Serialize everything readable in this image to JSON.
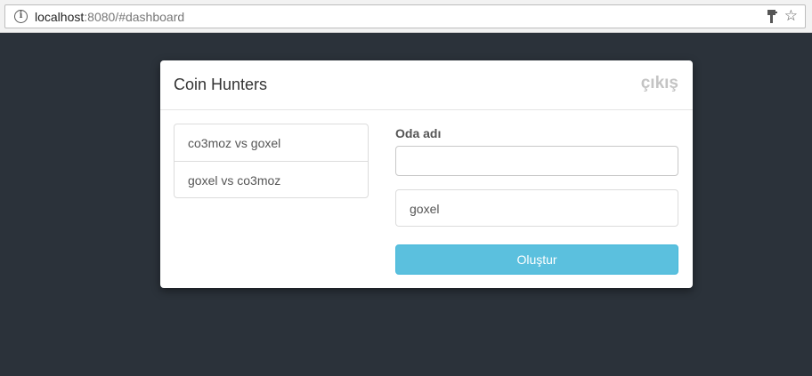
{
  "browser": {
    "url_host": "localhost",
    "url_rest": ":8080/#dashboard",
    "info_icon_glyph": "i",
    "icons": [
      "info-icon",
      "paint-icon",
      "star-icon"
    ]
  },
  "app": {
    "title": "Coin Hunters",
    "logout_label": "çıkış"
  },
  "rooms": [
    {
      "label": "co3moz vs goxel"
    },
    {
      "label": "goxel vs co3moz"
    }
  ],
  "form": {
    "room_name_label": "Oda adı",
    "room_name_value": "",
    "username": "goxel",
    "create_label": "Oluştur"
  },
  "colors": {
    "background": "#2b323a",
    "button": "#5bc0de",
    "logout": "#c4c4c4"
  }
}
